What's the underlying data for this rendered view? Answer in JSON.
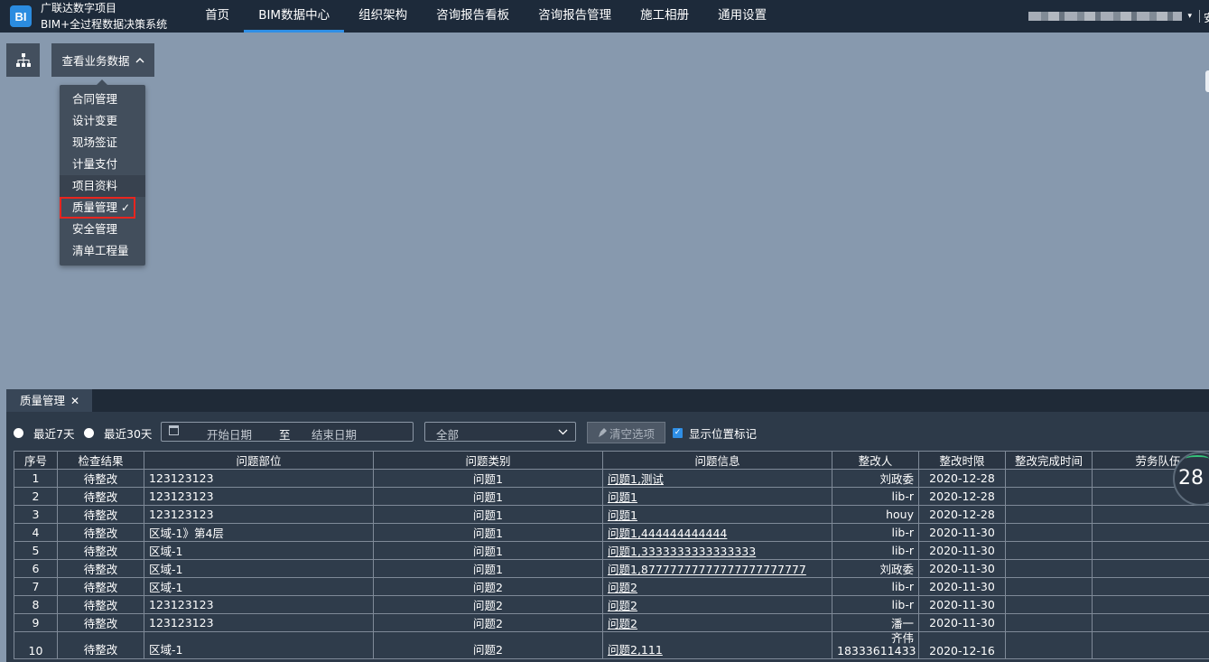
{
  "header": {
    "logo_text": "BI",
    "project_name": "广联达数字项目",
    "system_name": "BIM+全过程数据决策系统",
    "nav": [
      {
        "label": "首页",
        "active": false
      },
      {
        "label": "BIM数据中心",
        "active": true
      },
      {
        "label": "组织架构",
        "active": false
      },
      {
        "label": "咨询报告看板",
        "active": false
      },
      {
        "label": "咨询报告管理",
        "active": false
      },
      {
        "label": "施工相册",
        "active": false
      },
      {
        "label": "通用设置",
        "active": false
      }
    ],
    "user_caret": "▾",
    "user_tail": "安"
  },
  "toolbar": {
    "tree_icon": "org-tree-icon",
    "view_business_label": "查看业务数据",
    "view_business_chevron": "^"
  },
  "menu": {
    "items": [
      {
        "label": "合同管理"
      },
      {
        "label": "设计变更"
      },
      {
        "label": "现场签证"
      },
      {
        "label": "计量支付"
      },
      {
        "label": "项目资料"
      },
      {
        "label": "质量管理",
        "selected": true
      },
      {
        "label": "安全管理"
      },
      {
        "label": "清单工程量"
      }
    ],
    "check_mark": "✓"
  },
  "panel": {
    "tab_label": "质量管理",
    "tab_close": "✕",
    "filters": {
      "last7": "最近7天",
      "last30": "最近30天",
      "start_date": "开始日期",
      "to": "至",
      "end_date": "结束日期",
      "category_value": "全部",
      "clear_label": "清空选项",
      "show_marks_label": "显示位置标记",
      "show_marks_checked": true
    },
    "table": {
      "headers": [
        "序号",
        "检查结果",
        "问题部位",
        "问题类别",
        "问题信息",
        "整改人",
        "整改时限",
        "整改完成时间",
        "劳务队伍"
      ],
      "rows": [
        [
          "1",
          "待整改",
          "123123123",
          "问题1",
          "问题1,测试",
          "刘政委",
          "2020-12-28",
          "",
          ""
        ],
        [
          "2",
          "待整改",
          "123123123",
          "问题1",
          "问题1",
          "lib-r",
          "2020-12-28",
          "",
          ""
        ],
        [
          "3",
          "待整改",
          "123123123",
          "问题1",
          "问题1",
          "houy",
          "2020-12-28",
          "",
          ""
        ],
        [
          "4",
          "待整改",
          "区域-1》第4层",
          "问题1",
          "问题1,444444444444",
          "lib-r",
          "2020-11-30",
          "",
          ""
        ],
        [
          "5",
          "待整改",
          "区域-1",
          "问题1",
          "问题1,3333333333333333",
          "lib-r",
          "2020-11-30",
          "",
          ""
        ],
        [
          "6",
          "待整改",
          "区域-1",
          "问题1",
          "问题1,87777777777777777777777",
          "刘政委",
          "2020-11-30",
          "",
          ""
        ],
        [
          "7",
          "待整改",
          "区域-1",
          "问题2",
          "问题2",
          "lib-r",
          "2020-11-30",
          "",
          ""
        ],
        [
          "8",
          "待整改",
          "123123123",
          "问题2",
          "问题2",
          "lib-r",
          "2020-11-30",
          "",
          ""
        ],
        [
          "9",
          "待整改",
          "123123123",
          "问题2",
          "问题2",
          "潘一",
          "2020-11-30",
          "",
          ""
        ],
        [
          "10",
          "待整改",
          "区域-1",
          "问题2",
          "问题2,111",
          "齐伟18333611433",
          "2020-12-16",
          "",
          ""
        ]
      ]
    },
    "gauge_value": "28"
  }
}
